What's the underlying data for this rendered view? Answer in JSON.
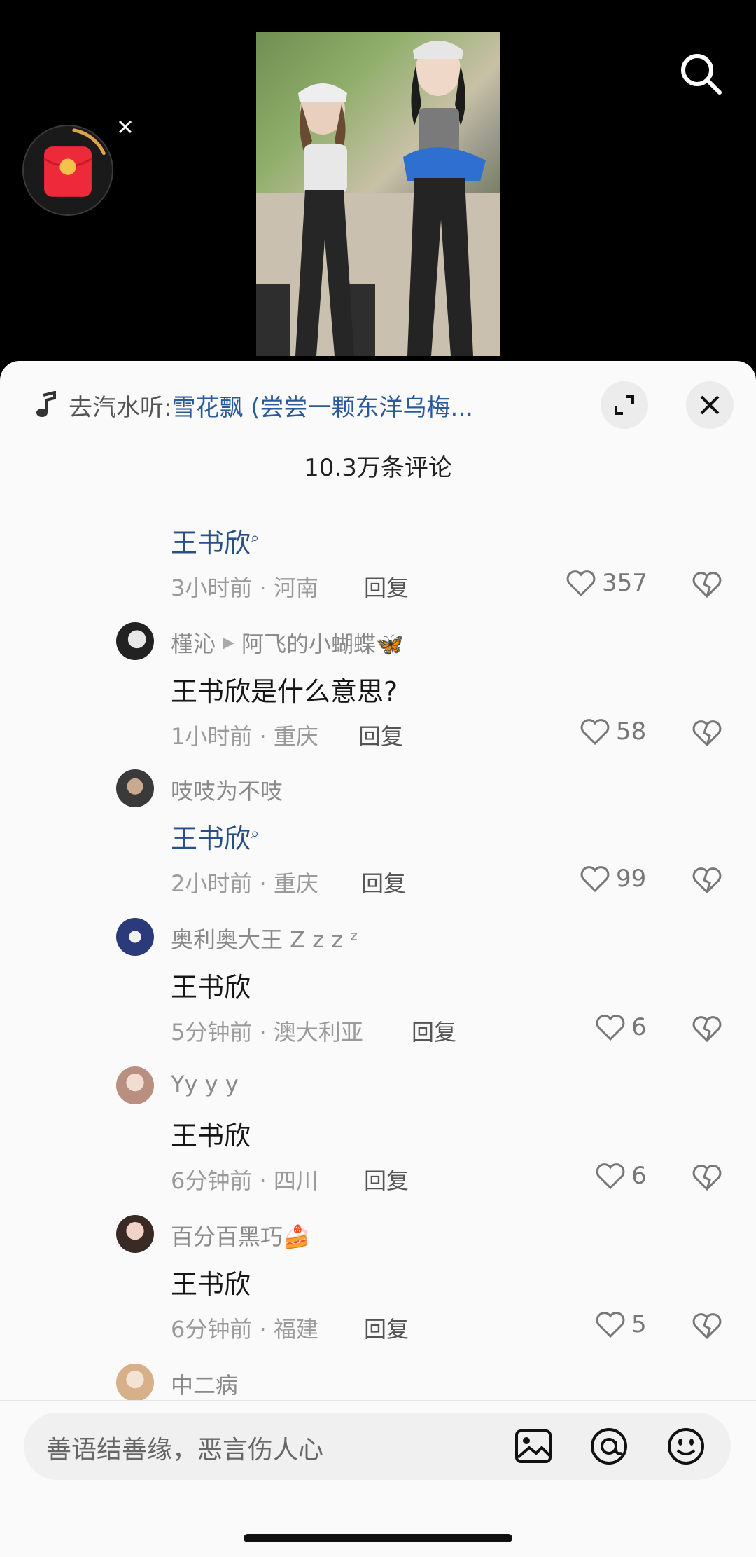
{
  "music": {
    "prefix": "去汽水听:",
    "title": "雪花飘 (尝尝一颗东洋乌梅..."
  },
  "comment_count": "10.3万条评论",
  "comments": [
    {
      "name": "",
      "reply_to": "",
      "text": "王书欣",
      "text_is_link": true,
      "time": "3小时前 · 河南",
      "reply": "回复",
      "likes": "357"
    },
    {
      "name": "槿沁",
      "reply_to": "阿飞的小蝴蝶🦋",
      "text": "王书欣是什么意思?",
      "text_is_link": false,
      "time": "1小时前 · 重庆",
      "reply": "回复",
      "likes": "58"
    },
    {
      "name": "吱吱为不吱",
      "reply_to": "",
      "text": "王书欣",
      "text_is_link": true,
      "time": "2小时前 · 重庆",
      "reply": "回复",
      "likes": "99"
    },
    {
      "name": "奥利奥大王 Z z z ᶻ",
      "reply_to": "",
      "text": "王书欣",
      "text_is_link": false,
      "time": "5分钟前 · 澳大利亚",
      "reply": "回复",
      "likes": "6"
    },
    {
      "name": "Yy y y",
      "reply_to": "",
      "text": "王书欣",
      "text_is_link": false,
      "time": "6分钟前 · 四川",
      "reply": "回复",
      "likes": "6"
    },
    {
      "name": "百分百黑巧🍰",
      "reply_to": "",
      "text": "王书欣",
      "text_is_link": false,
      "time": "6分钟前 · 福建",
      "reply": "回复",
      "likes": "5"
    },
    {
      "name": "中二病",
      "reply_to": "",
      "text": "",
      "text_is_link": false,
      "time": "",
      "reply": "",
      "likes": ""
    }
  ],
  "input": {
    "placeholder": "善语结善缘，恶言伤人心"
  },
  "icons": {
    "search": "search-icon",
    "red_packet": "red-packet-icon",
    "expand": "expand-icon",
    "close": "close-icon",
    "music": "music-note-icon",
    "like": "heart-icon",
    "dislike": "broken-heart-icon",
    "image": "image-icon",
    "mention": "at-icon",
    "emoji": "emoji-icon"
  },
  "colors": {
    "link": "#2a4f86",
    "sheet_bg": "#fafafa",
    "red_packet": "#ee2a3a"
  }
}
